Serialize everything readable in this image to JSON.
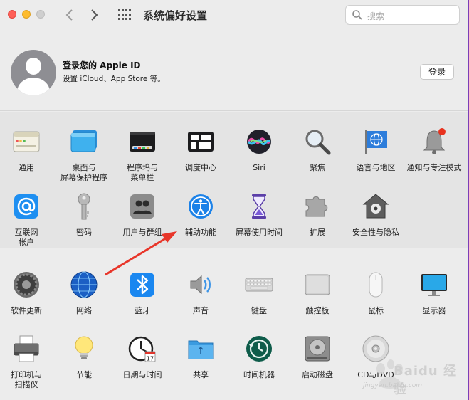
{
  "window": {
    "title": "系统偏好设置",
    "accent_color": "#7b3fb8"
  },
  "toolbar": {
    "back_icon": "chevron-left-icon",
    "forward_icon": "chevron-right-icon",
    "show_all_icon": "grid-icon",
    "search_placeholder": "搜索"
  },
  "account": {
    "title": "登录您的 Apple ID",
    "subtitle": "设置 iCloud、App Store 等。",
    "login_label": "登录"
  },
  "personal_items": [
    {
      "label": "通用",
      "icon": "general-icon"
    },
    {
      "label": "桌面与\n屏幕保护程序",
      "icon": "desktop-icon"
    },
    {
      "label": "程序坞与\n菜单栏",
      "icon": "dock-icon"
    },
    {
      "label": "调度中心",
      "icon": "mission-control-icon"
    },
    {
      "label": "Siri",
      "icon": "siri-icon"
    },
    {
      "label": "聚焦",
      "icon": "spotlight-icon"
    },
    {
      "label": "语言与地区",
      "icon": "language-flag-icon"
    },
    {
      "label": "通知与专注模式",
      "icon": "notification-bell-icon"
    },
    {
      "label": "互联网\n帐户",
      "icon": "at-sign-icon"
    },
    {
      "label": "密码",
      "icon": "key-icon"
    },
    {
      "label": "用户与群组",
      "icon": "users-icon"
    },
    {
      "label": "辅助功能",
      "icon": "accessibility-icon"
    },
    {
      "label": "屏幕使用时间",
      "icon": "hourglass-icon"
    },
    {
      "label": "扩展",
      "icon": "puzzle-icon"
    },
    {
      "label": "安全性与隐私",
      "icon": "house-lock-icon"
    }
  ],
  "hardware_items": [
    {
      "label": "软件更新",
      "icon": "gear-icon"
    },
    {
      "label": "网络",
      "icon": "globe-icon"
    },
    {
      "label": "蓝牙",
      "icon": "bluetooth-icon"
    },
    {
      "label": "声音",
      "icon": "speaker-icon"
    },
    {
      "label": "键盘",
      "icon": "keyboard-icon"
    },
    {
      "label": "触控板",
      "icon": "trackpad-icon"
    },
    {
      "label": "鼠标",
      "icon": "mouse-icon"
    },
    {
      "label": "显示器",
      "icon": "display-icon"
    },
    {
      "label": "打印机与\n扫描仪",
      "icon": "printer-icon"
    },
    {
      "label": "节能",
      "icon": "lightbulb-icon"
    },
    {
      "label": "日期与时间",
      "icon": "clock-icon"
    },
    {
      "label": "共享",
      "icon": "folder-icon"
    },
    {
      "label": "时间机器",
      "icon": "time-machine-icon"
    },
    {
      "label": "启动磁盘",
      "icon": "disk-icon"
    },
    {
      "label": "CD与DVD",
      "icon": "cd-icon"
    }
  ],
  "calendar_day": "17",
  "watermark": {
    "text": "Baidu 经验",
    "sub": "jingyan.baidu.com"
  }
}
